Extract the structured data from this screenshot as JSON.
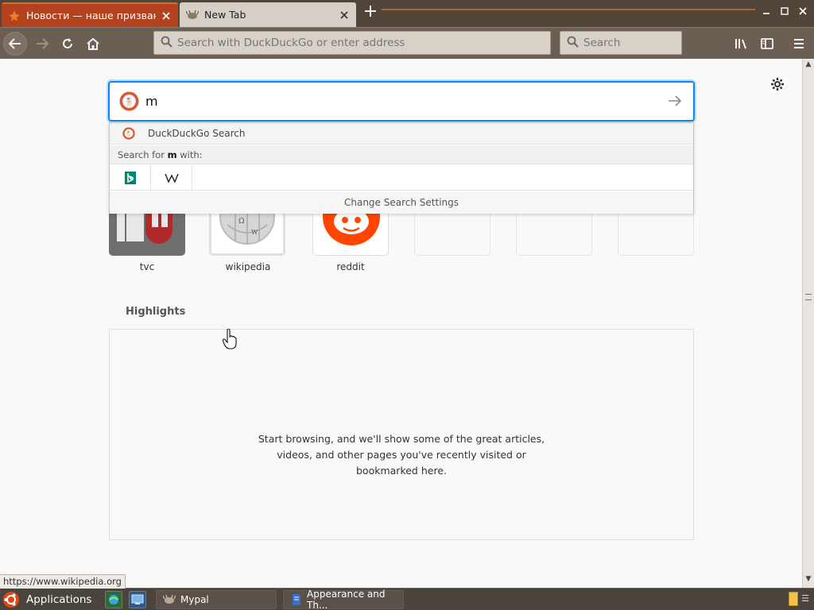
{
  "tabs": [
    {
      "title": "Новости — наше призвание",
      "active": false
    },
    {
      "title": "New Tab",
      "active": true
    }
  ],
  "navbar": {
    "url_placeholder": "Search with DuckDuckGo or enter address",
    "search_placeholder": "Search"
  },
  "newtab": {
    "search_value": "m",
    "suggestion": "DuckDuckGo Search",
    "search_for_prefix": "Search for ",
    "search_for_term": "m",
    "search_for_suffix": " with:",
    "engines": [
      "bing",
      "wikipedia"
    ],
    "change_settings": "Change Search Settings",
    "tiles": [
      {
        "label": "tvc"
      },
      {
        "label": "wikipedia"
      },
      {
        "label": "reddit"
      },
      {
        "label": ""
      },
      {
        "label": ""
      },
      {
        "label": ""
      }
    ],
    "highlights_title": "Highlights",
    "highlights_empty": [
      "Start browsing, and we'll show some of the great articles,",
      "videos, and other pages you've recently visited or",
      "bookmarked here."
    ]
  },
  "status_link": "https://www.wikipedia.org",
  "taskbar": {
    "apps_label": "Applications",
    "tasks": [
      {
        "label": "Mypal"
      },
      {
        "label": "Appearance and Th..."
      }
    ]
  },
  "colors": {
    "accent": "#0a84ff",
    "active_tab": "#b5421e",
    "toolbar": "#6b5e52",
    "ddg_orange": "#de5833",
    "reddit_orange": "#ff4500"
  }
}
